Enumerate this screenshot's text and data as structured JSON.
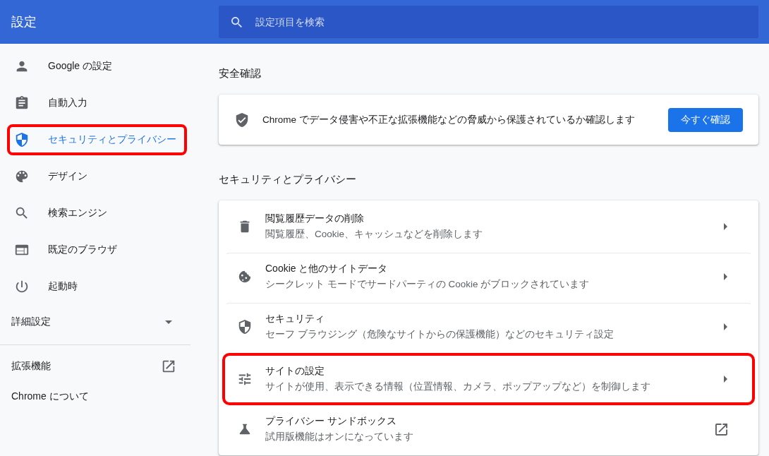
{
  "header": {
    "title": "設定",
    "search": {
      "placeholder": "設定項目を検索"
    }
  },
  "sidebar": {
    "items": [
      {
        "label": "Google の設定",
        "selected": false,
        "highlighted": false
      },
      {
        "label": "自動入力",
        "selected": false,
        "highlighted": false
      },
      {
        "label": "セキュリティとプライバシー",
        "selected": true,
        "highlighted": true
      },
      {
        "label": "デザイン",
        "selected": false,
        "highlighted": false
      },
      {
        "label": "検索エンジン",
        "selected": false,
        "highlighted": false
      },
      {
        "label": "既定のブラウザ",
        "selected": false,
        "highlighted": false
      },
      {
        "label": "起動時",
        "selected": false,
        "highlighted": false
      }
    ],
    "advanced": {
      "label": "詳細設定",
      "expanded": false
    },
    "extensions": {
      "label": "拡張機能"
    },
    "about": {
      "label": "Chrome について"
    }
  },
  "safety_check": {
    "heading": "安全確認",
    "text": "Chrome でデータ侵害や不正な拡張機能などの脅威から保護されているか確認します",
    "button": "今すぐ確認"
  },
  "privacy": {
    "heading": "セキュリティとプライバシー",
    "rows": [
      {
        "title": "閲覧履歴データの削除",
        "subtitle": "閲覧履歴、Cookie、キャッシュなどを削除します",
        "kind": "arrow",
        "highlighted": false
      },
      {
        "title": "Cookie と他のサイトデータ",
        "subtitle": "シークレット モードでサードパーティの Cookie がブロックされています",
        "kind": "arrow",
        "highlighted": false
      },
      {
        "title": "セキュリティ",
        "subtitle": "セーフ ブラウジング（危険なサイトからの保護機能）などのセキュリティ設定",
        "kind": "arrow",
        "highlighted": false
      },
      {
        "title": "サイトの設定",
        "subtitle": "サイトが使用、表示できる情報（位置情報、カメラ、ポップアップなど）を制御します",
        "kind": "arrow",
        "highlighted": true
      },
      {
        "title": "プライバシー サンドボックス",
        "subtitle": "試用版機能はオンになっています",
        "kind": "external",
        "highlighted": false
      }
    ]
  }
}
